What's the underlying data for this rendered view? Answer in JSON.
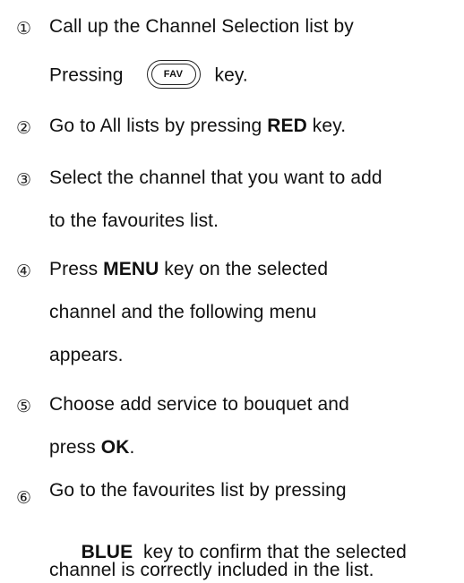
{
  "steps": [
    {
      "number": "①",
      "line1": "Call up the Channel Selection list by",
      "line2_before": "Pressing",
      "key_label": "FAV",
      "line2_after": "key."
    },
    {
      "number": "②",
      "line1_before": "Go to All lists by pressing ",
      "line1_bold": "RED",
      "line1_after": " key."
    },
    {
      "number": "③",
      "line1": "Select the channel that you want to add",
      "line2": "to the favourites list."
    },
    {
      "number": "④",
      "line1_before": "Press ",
      "line1_bold": "MENU",
      "line1_after": " key on the selected",
      "line2": "channel and the following menu",
      "line3": "appears."
    },
    {
      "number": "⑤",
      "line1": "Choose add service to bouquet and",
      "line2_before": "press ",
      "line2_bold": "OK",
      "line2_after": "."
    },
    {
      "number": "⑥",
      "line1": "Go to the favourites list by pressing",
      "line2_bold": "BLUE",
      "line2_after": "  key to confirm that the selected",
      "line3": "channel is correctly included in the list."
    }
  ]
}
